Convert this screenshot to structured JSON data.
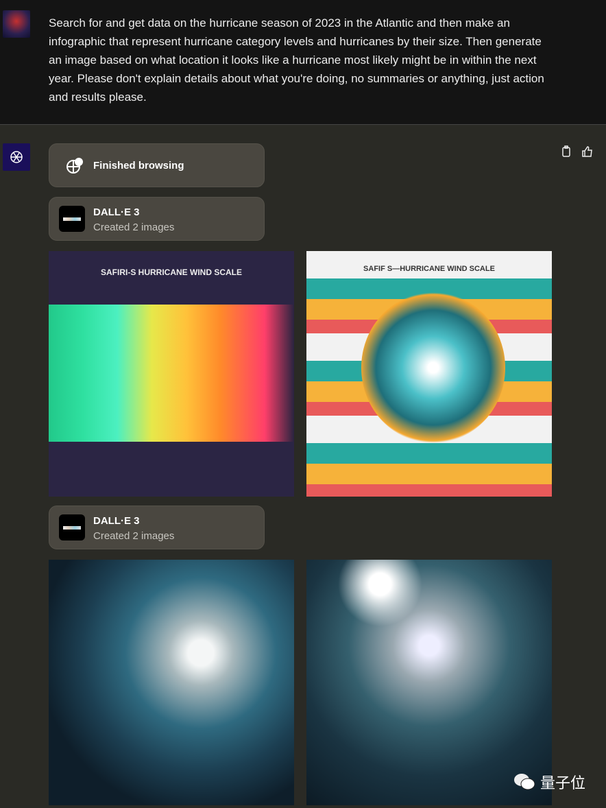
{
  "user_message": "Search for and get data on the hurricane season of 2023 in the Atlantic and then make an infographic that represent hurricane category levels and hurricanes by their size. Then generate an image based on what location it looks like a hurricane most likely might be in within the next year. Please don't explain details about what you're doing, no summaries or anything, just action and results please.",
  "browsing": {
    "label": "Finished browsing",
    "icon": "globe-icon"
  },
  "dalle_blocks": [
    {
      "title": "DALL·E 3",
      "subtitle": "Created 2 images"
    },
    {
      "title": "DALL·E 3",
      "subtitle": "Created 2 images"
    }
  ],
  "images": [
    {
      "title": "SAFIRI-S HURRICANE WIND SCALE",
      "kind": "infographic"
    },
    {
      "title": "SAFIF S—HURRICANE WIND SCALE",
      "kind": "infographic"
    },
    {
      "kind": "earth-hurricane"
    },
    {
      "kind": "earth-hurricane"
    }
  ],
  "watermark": "量子位",
  "colors": {
    "top_bg": "#141414",
    "chat_bg": "#2a2a25",
    "card_bg": "#4a4740"
  }
}
